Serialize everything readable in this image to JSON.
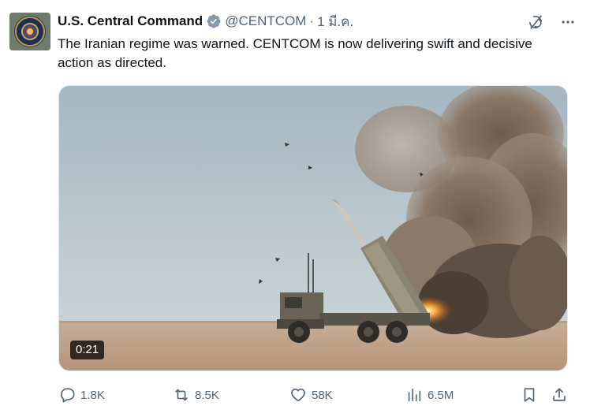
{
  "tweet": {
    "author": {
      "display_name": "U.S. Central Command",
      "handle": "@CENTCOM",
      "verified_icon": "verified-badge-icon"
    },
    "separator": "·",
    "date": "1 มี.ค.",
    "text": "The Iranian regime was warned. CENTCOM is now delivering swift and decisive action as directed.",
    "media": {
      "type": "video",
      "duration": "0:21"
    },
    "top_icons": [
      "grok-icon",
      "more-icon"
    ],
    "metrics": {
      "replies": "1.8K",
      "reposts": "8.5K",
      "likes": "58K",
      "views": "6.5M"
    },
    "colors": {
      "text": "#0f1419",
      "secondary": "#536471",
      "verified": "#829aab"
    }
  }
}
